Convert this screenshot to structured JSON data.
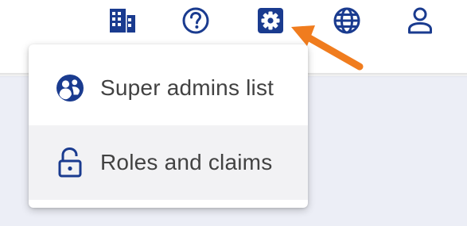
{
  "toolbar": {
    "icons": [
      {
        "name": "organization-icon"
      },
      {
        "name": "help-icon"
      },
      {
        "name": "settings-icon"
      },
      {
        "name": "language-globe-icon"
      },
      {
        "name": "account-icon"
      }
    ]
  },
  "settings_menu": {
    "items": [
      {
        "label": "Super admins list",
        "icon": "super-admins-icon"
      },
      {
        "label": "Roles and claims",
        "icon": "unlocked-padlock-icon"
      }
    ]
  },
  "colors": {
    "icon_primary": "#1a3b8f",
    "menu_text": "#424242",
    "arrow": "#f07c1e",
    "content_bg": "#eceef6",
    "hover_bg": "#f2f2f4"
  }
}
